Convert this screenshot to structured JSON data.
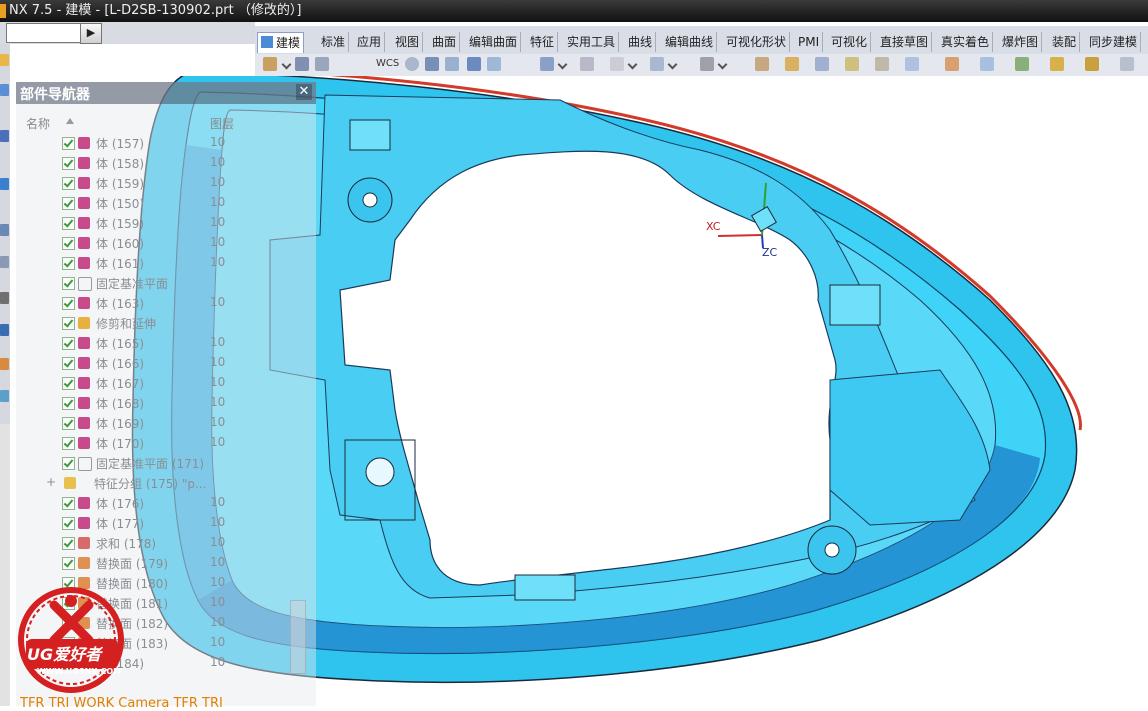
{
  "window": {
    "title": "NX 7.5 - 建模 - [L-D2SB-130902.prt （修改的）]"
  },
  "selection_bar": {
    "arrow_glyph": "▶"
  },
  "tabs": [
    {
      "label": "建模",
      "active": true
    },
    {
      "label": "标准"
    },
    {
      "label": "应用"
    },
    {
      "label": "视图"
    },
    {
      "label": "曲面"
    },
    {
      "label": "编辑曲面"
    },
    {
      "label": "特征"
    },
    {
      "label": "实用工具"
    },
    {
      "label": "曲线"
    },
    {
      "label": "编辑曲线"
    },
    {
      "label": "可视化形状"
    },
    {
      "label": "PMI"
    },
    {
      "label": "可视化"
    },
    {
      "label": "直接草图"
    },
    {
      "label": "真实着色"
    },
    {
      "label": "爆炸图"
    },
    {
      "label": "装配"
    },
    {
      "label": "同步建模"
    }
  ],
  "toolbar": {
    "wcs_label": "WCS"
  },
  "navigator": {
    "title": "部件导航器",
    "close_glyph": "✕",
    "columns": {
      "name": "名称",
      "layer": "图层"
    },
    "rows": [
      {
        "name": "体 (157)",
        "layer": "10",
        "icon": "body-icon"
      },
      {
        "name": "体 (158)",
        "layer": "10",
        "icon": "body-icon"
      },
      {
        "name": "体 (159)",
        "layer": "10",
        "icon": "body-icon"
      },
      {
        "name": "体 (150)",
        "layer": "10",
        "icon": "body-icon"
      },
      {
        "name": "体 (159)",
        "layer": "10",
        "icon": "body-icon"
      },
      {
        "name": "体 (160)",
        "layer": "10",
        "icon": "body-icon"
      },
      {
        "name": "体 (161)",
        "layer": "10",
        "icon": "body-icon"
      },
      {
        "name": "固定基准平面",
        "layer": "",
        "icon": "datum-plane-icon"
      },
      {
        "name": "体 (163)",
        "layer": "10",
        "icon": "body-icon"
      },
      {
        "name": "修剪和延伸",
        "layer": "",
        "icon": "trim-extend-icon"
      },
      {
        "name": "体 (165)",
        "layer": "10",
        "icon": "body-icon"
      },
      {
        "name": "体 (166)",
        "layer": "10",
        "icon": "body-icon"
      },
      {
        "name": "体 (167)",
        "layer": "10",
        "icon": "body-icon"
      },
      {
        "name": "体 (168)",
        "layer": "10",
        "icon": "body-icon"
      },
      {
        "name": "体 (169)",
        "layer": "10",
        "icon": "body-icon"
      },
      {
        "name": "体 (170)",
        "layer": "10",
        "icon": "body-icon"
      },
      {
        "name": "固定基准平面 (171)",
        "layer": "",
        "icon": "datum-plane-icon"
      },
      {
        "name": "特征分组 (175) \"p...",
        "layer": "",
        "icon": "feature-group-icon",
        "expand": "+"
      },
      {
        "name": "体 (176)",
        "layer": "10",
        "icon": "body-icon"
      },
      {
        "name": "体 (177)",
        "layer": "10",
        "icon": "body-icon"
      },
      {
        "name": "求和 (178)",
        "layer": "10",
        "icon": "unite-icon"
      },
      {
        "name": "替换面 (179)",
        "layer": "10",
        "icon": "replace-face-icon"
      },
      {
        "name": "替换面 (180)",
        "layer": "10",
        "icon": "replace-face-icon"
      },
      {
        "name": "替换面 (181)",
        "layer": "10",
        "icon": "replace-face-icon"
      },
      {
        "name": "替换面 (182)",
        "layer": "10",
        "icon": "replace-face-icon"
      },
      {
        "name": "替换面 (183)",
        "layer": "10",
        "icon": "replace-face-icon"
      },
      {
        "name": "体 (184)",
        "layer": "10",
        "icon": "body-icon"
      }
    ]
  },
  "viewport": {
    "axis_x": "XC",
    "axis_z": "ZC"
  },
  "status": {
    "text": "TFR TRI WORK Camera TFR TRI"
  },
  "logo": {
    "text": "UG爱好者",
    "url": "WWW.UGSNX.COM"
  },
  "colors": {
    "part_fill": "#2fc4ee",
    "accent_red": "#d23a2a",
    "tab_bg": "#d9dde6"
  }
}
